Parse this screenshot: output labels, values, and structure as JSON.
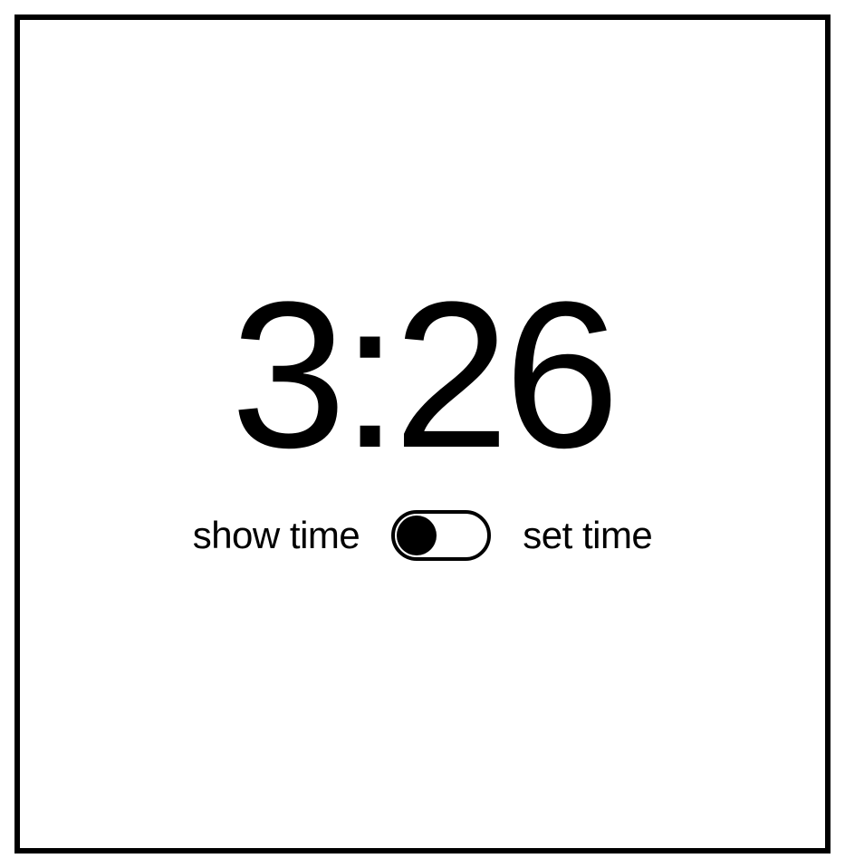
{
  "clock": {
    "time_display": "3:26"
  },
  "toggle": {
    "left_label": "show time",
    "right_label": "set time",
    "position": "left"
  }
}
